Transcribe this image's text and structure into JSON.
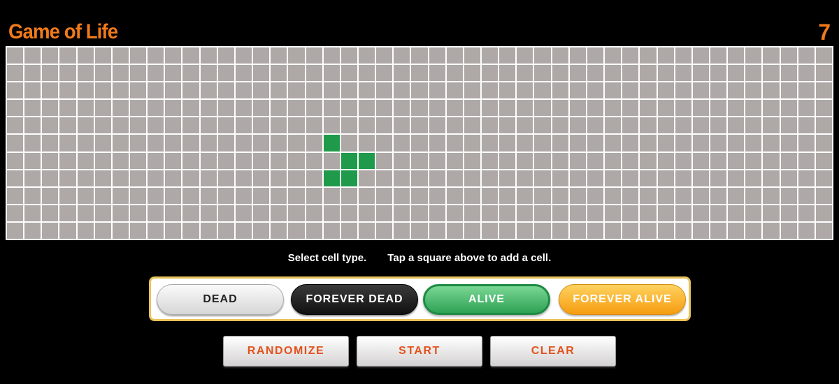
{
  "header": {
    "title": "Game of Life",
    "generation": "7"
  },
  "board": {
    "cols": 47,
    "rows": 11,
    "alive_cells": [
      [
        5,
        18
      ],
      [
        6,
        19
      ],
      [
        6,
        20
      ],
      [
        7,
        18
      ],
      [
        7,
        19
      ]
    ],
    "colors": {
      "dead": "#aea8a6",
      "alive": "#1e9a4a",
      "grid": "#ffffff"
    }
  },
  "hint": {
    "select": "Select cell type.",
    "tap": "Tap a square above to add a cell."
  },
  "cell_types": {
    "dead": "DEAD",
    "forever_dead": "FOREVER DEAD",
    "alive": "ALIVE",
    "forever_alive": "FOREVER ALIVE",
    "selected": "alive"
  },
  "actions": {
    "randomize": "RANDOMIZE",
    "start": "START",
    "clear": "CLEAR"
  },
  "colors": {
    "accent": "#f07a1a",
    "action_text": "#e2521c"
  }
}
